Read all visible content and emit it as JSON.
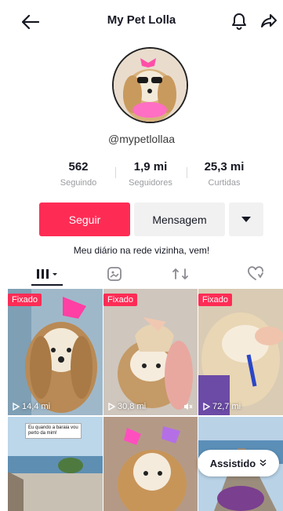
{
  "header": {
    "title": "My Pet Lolla"
  },
  "profile": {
    "username": "@mypetlollaa",
    "bio": "Meu diário na rede vizinha, vem!"
  },
  "stats": [
    {
      "value": "562",
      "label": "Seguindo"
    },
    {
      "value": "1,9 mi",
      "label": "Seguidores"
    },
    {
      "value": "25,3 mi",
      "label": "Curtidas"
    }
  ],
  "actions": {
    "follow_label": "Seguir",
    "message_label": "Mensagem"
  },
  "tabs": [
    {
      "icon": "grid-icon",
      "selected": true
    },
    {
      "icon": "repost-frame-icon",
      "selected": false
    },
    {
      "icon": "repost-icon",
      "selected": false
    },
    {
      "icon": "liked-heart-icon",
      "selected": false
    }
  ],
  "videos": [
    {
      "pinned_label": "Fixado",
      "views": "14,4 mi"
    },
    {
      "pinned_label": "Fixado",
      "views": "30,8 mi"
    },
    {
      "pinned_label": "Fixado",
      "views": "72,7 mi"
    },
    {
      "caption": "Eu quando a baraia vou perto da mim!"
    },
    {},
    {}
  ],
  "overlay": {
    "watched_label": "Assistido"
  },
  "colors": {
    "accent": "#fe2c55",
    "secondary_button": "#f1f1f2",
    "muted_text": "#9a9ba0"
  }
}
